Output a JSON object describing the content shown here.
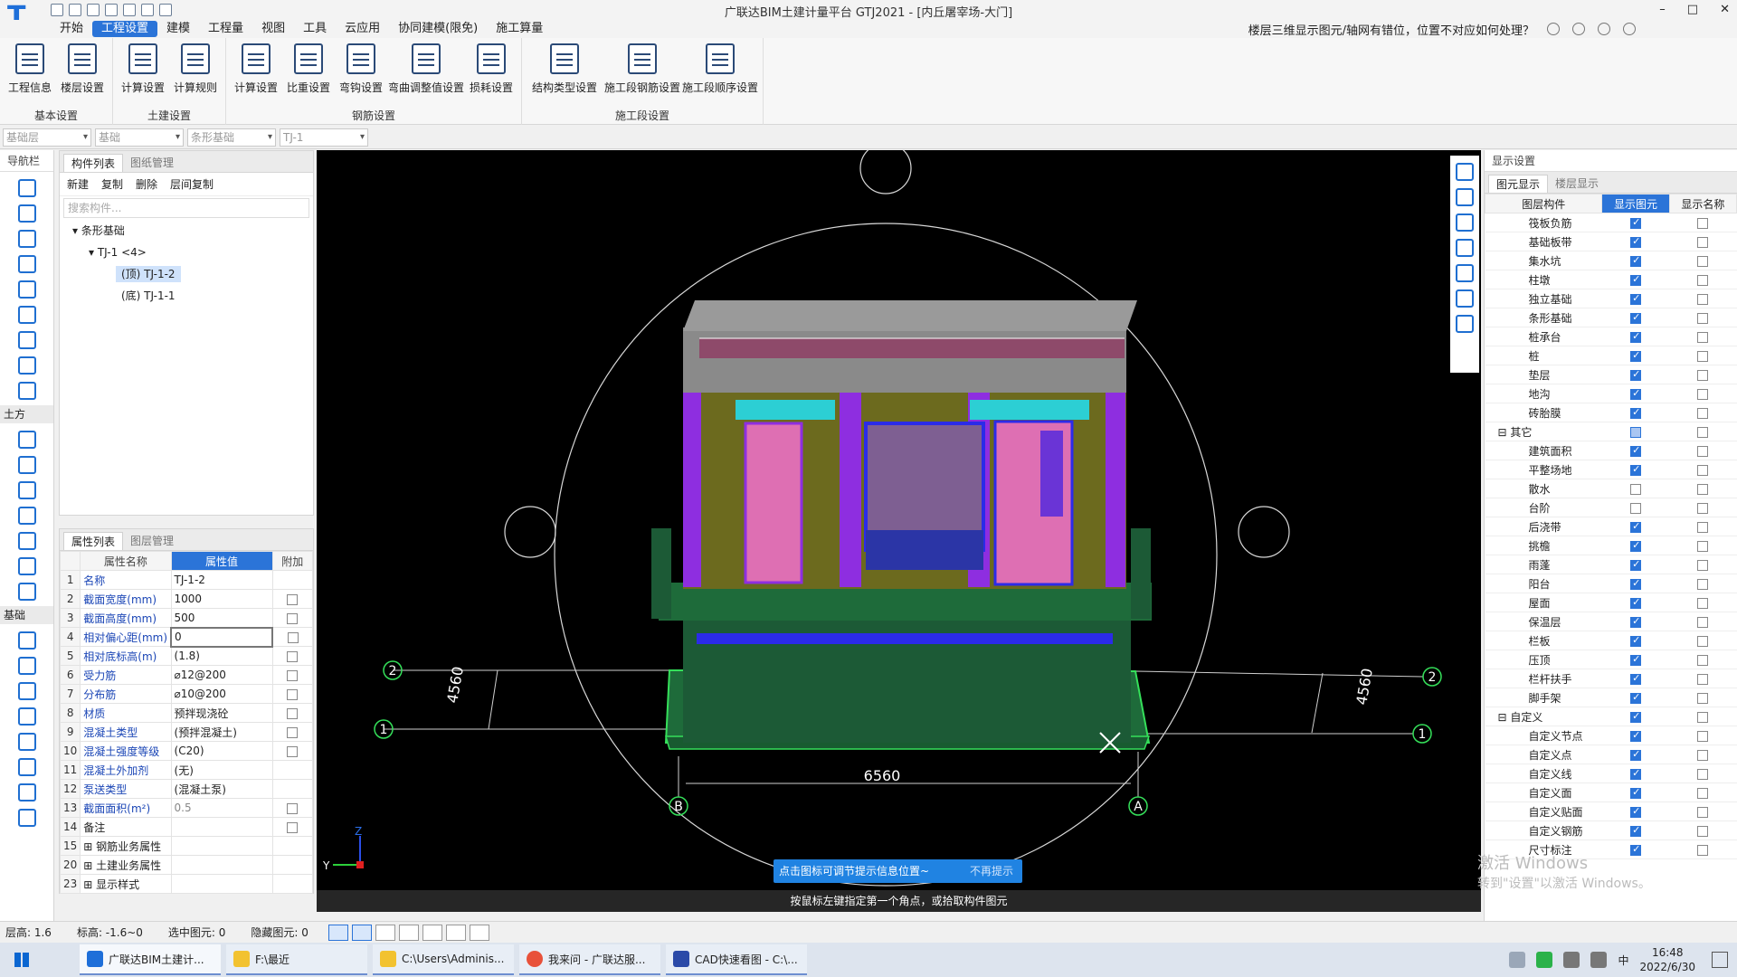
{
  "app": {
    "title": "广联达BIM土建计量平台 GTJ2021 - [内丘屠宰场-大门]",
    "window_buttons": [
      "–",
      "□",
      "✕"
    ],
    "ribbon_collapse": "⌃"
  },
  "menu": {
    "items": [
      "开始",
      "工程设置",
      "建模",
      "工程量",
      "视图",
      "工具",
      "云应用",
      "协同建模(限免)",
      "施工算量"
    ],
    "active": "工程设置"
  },
  "help": {
    "question": "楼层三维显示图元/轴网有错位，位置不对应如何处理？"
  },
  "ribbon": {
    "groups": [
      {
        "label": "基本设置",
        "buttons": [
          "工程信息",
          "楼层设置"
        ]
      },
      {
        "label": "土建设置",
        "buttons": [
          "计算设置",
          "计算规则"
        ]
      },
      {
        "label": "钢筋设置",
        "buttons": [
          "计算设置",
          "比重设置",
          "弯钩设置",
          "弯曲调整值设置",
          "损耗设置"
        ]
      },
      {
        "label": "施工段设置",
        "buttons": [
          "结构类型设置",
          "施工段钢筋设置",
          "施工段顺序设置"
        ]
      }
    ]
  },
  "filters": [
    "基础层",
    "基础",
    "条形基础",
    "TJ-1"
  ],
  "nav": {
    "title": "导航栏",
    "sections": [
      "土方",
      "基础"
    ]
  },
  "component_list": {
    "tabs": [
      "构件列表",
      "图纸管理"
    ],
    "tools": [
      "新建",
      "复制",
      "删除",
      "层间复制"
    ],
    "search_placeholder": "搜索构件...",
    "tree": {
      "root": "条形基础",
      "child": "TJ-1 <4>",
      "leaves": [
        "(顶) TJ-1-2",
        "(底) TJ-1-1"
      ]
    }
  },
  "property_list": {
    "tabs": [
      "属性列表",
      "图层管理"
    ],
    "headers": [
      "属性名称",
      "属性值",
      "附加"
    ],
    "rows": [
      {
        "n": "1",
        "name": "名称",
        "value": "TJ-1-2",
        "blue": true,
        "cb": false
      },
      {
        "n": "2",
        "name": "截面宽度(mm)",
        "value": "1000",
        "blue": true,
        "cb": true
      },
      {
        "n": "3",
        "name": "截面高度(mm)",
        "value": "500",
        "blue": true,
        "cb": true
      },
      {
        "n": "4",
        "name": "相对偏心距(mm)",
        "value": "0",
        "blue": true,
        "cb": true,
        "edit": true
      },
      {
        "n": "5",
        "name": "相对底标高(m)",
        "value": "(1.8)",
        "blue": true,
        "cb": true
      },
      {
        "n": "6",
        "name": "受力筋",
        "value": "⌀12@200",
        "blue": true,
        "cb": true
      },
      {
        "n": "7",
        "name": "分布筋",
        "value": "⌀10@200",
        "blue": true,
        "cb": true
      },
      {
        "n": "8",
        "name": "材质",
        "value": "预拌现浇砼",
        "blue": true,
        "cb": true
      },
      {
        "n": "9",
        "name": "混凝土类型",
        "value": "(预拌混凝土)",
        "blue": true,
        "cb": true
      },
      {
        "n": "10",
        "name": "混凝土强度等级",
        "value": "(C20)",
        "blue": true,
        "cb": true
      },
      {
        "n": "11",
        "name": "混凝土外加剂",
        "value": "(无)",
        "blue": true,
        "cb": false
      },
      {
        "n": "12",
        "name": "泵送类型",
        "value": "(混凝土泵)",
        "blue": true,
        "cb": false
      },
      {
        "n": "13",
        "name": "截面面积(m²)",
        "value": "0.5",
        "blue": true,
        "cb": true,
        "gray": true
      },
      {
        "n": "14",
        "name": "备注",
        "value": "",
        "blue": false,
        "cb": true
      },
      {
        "n": "15",
        "name": "⊞ 钢筋业务属性",
        "value": "",
        "blue": false,
        "cb": false
      },
      {
        "n": "20",
        "name": "⊞ 土建业务属性",
        "value": "",
        "blue": false,
        "cb": false
      },
      {
        "n": "23",
        "name": "⊞ 显示样式",
        "value": "",
        "blue": false,
        "cb": false
      }
    ]
  },
  "viewport": {
    "dims": {
      "top": "4560",
      "right": "4560",
      "bottom": "6560"
    },
    "axes": {
      "left_top": "2",
      "left_bottom": "1",
      "right_top": "2",
      "right_bottom": "1",
      "bottom_left": "B",
      "bottom_right": "A"
    },
    "axis_z": "Z",
    "axis_y": "Y"
  },
  "hint": {
    "text": "点击图标可调节提示信息位置~",
    "dismiss": "不再提示"
  },
  "prompt": "按鼠标左键指定第一个角点，或拾取构件图元",
  "display": {
    "title": "显示设置",
    "tabs": [
      "图元显示",
      "楼层显示"
    ],
    "headers": [
      "图层构件",
      "显示图元",
      "显示名称"
    ],
    "rows": [
      {
        "name": "筏板负筋",
        "s": "on",
        "n": "off"
      },
      {
        "name": "基础板带",
        "s": "on",
        "n": "off"
      },
      {
        "name": "集水坑",
        "s": "on",
        "n": "off"
      },
      {
        "name": "柱墩",
        "s": "on",
        "n": "off"
      },
      {
        "name": "独立基础",
        "s": "on",
        "n": "off"
      },
      {
        "name": "条形基础",
        "s": "on",
        "n": "off"
      },
      {
        "name": "桩承台",
        "s": "on",
        "n": "off"
      },
      {
        "name": "桩",
        "s": "on",
        "n": "off"
      },
      {
        "name": "垫层",
        "s": "on",
        "n": "off"
      },
      {
        "name": "地沟",
        "s": "on",
        "n": "off"
      },
      {
        "name": "砖胎膜",
        "s": "on",
        "n": "off"
      },
      {
        "name": "⊟ 其它",
        "s": "mid",
        "n": "off",
        "grp": true
      },
      {
        "name": "建筑面积",
        "s": "on",
        "n": "off"
      },
      {
        "name": "平整场地",
        "s": "on",
        "n": "off"
      },
      {
        "name": "散水",
        "s": "off",
        "n": "off"
      },
      {
        "name": "台阶",
        "s": "off",
        "n": "off"
      },
      {
        "name": "后浇带",
        "s": "on",
        "n": "off"
      },
      {
        "name": "挑檐",
        "s": "on",
        "n": "off"
      },
      {
        "name": "雨蓬",
        "s": "on",
        "n": "off"
      },
      {
        "name": "阳台",
        "s": "on",
        "n": "off"
      },
      {
        "name": "屋面",
        "s": "on",
        "n": "off"
      },
      {
        "name": "保温层",
        "s": "on",
        "n": "off"
      },
      {
        "name": "栏板",
        "s": "on",
        "n": "off"
      },
      {
        "name": "压顶",
        "s": "on",
        "n": "off"
      },
      {
        "name": "栏杆扶手",
        "s": "on",
        "n": "off"
      },
      {
        "name": "脚手架",
        "s": "on",
        "n": "off"
      },
      {
        "name": "⊟ 自定义",
        "s": "on",
        "n": "off",
        "grp": true
      },
      {
        "name": "自定义节点",
        "s": "on",
        "n": "off"
      },
      {
        "name": "自定义点",
        "s": "on",
        "n": "off"
      },
      {
        "name": "自定义线",
        "s": "on",
        "n": "off"
      },
      {
        "name": "自定义面",
        "s": "on",
        "n": "off"
      },
      {
        "name": "自定义贴面",
        "s": "on",
        "n": "off"
      },
      {
        "name": "自定义钢筋",
        "s": "on",
        "n": "off"
      },
      {
        "name": "尺寸标注",
        "s": "on",
        "n": "off"
      }
    ]
  },
  "watermark": {
    "line1": "激活 Windows",
    "line2": "转到\"设置\"以激活 Windows。"
  },
  "status": {
    "floor_height": "层高:  1.6",
    "elevation": "标高:  -1.6~0",
    "selected": "选中图元:  0",
    "hidden": "隐藏图元:  0"
  },
  "taskbar": {
    "items": [
      "广联达BIM土建计...",
      "F:\\最近",
      "C:\\Users\\Adminis...",
      "我来问 - 广联达服...",
      "CAD快速看图 - C:\\..."
    ],
    "ime": "中",
    "time": "16:48",
    "date": "2022/6/30"
  },
  "colors": {
    "accent": "#2b74d8",
    "viewport_bg": "#000000",
    "foundation": "#1c5a36",
    "wall_purple": "#8e2ee0",
    "wall_olive": "#6c6a1e",
    "highlight_green": "#35e05a"
  }
}
